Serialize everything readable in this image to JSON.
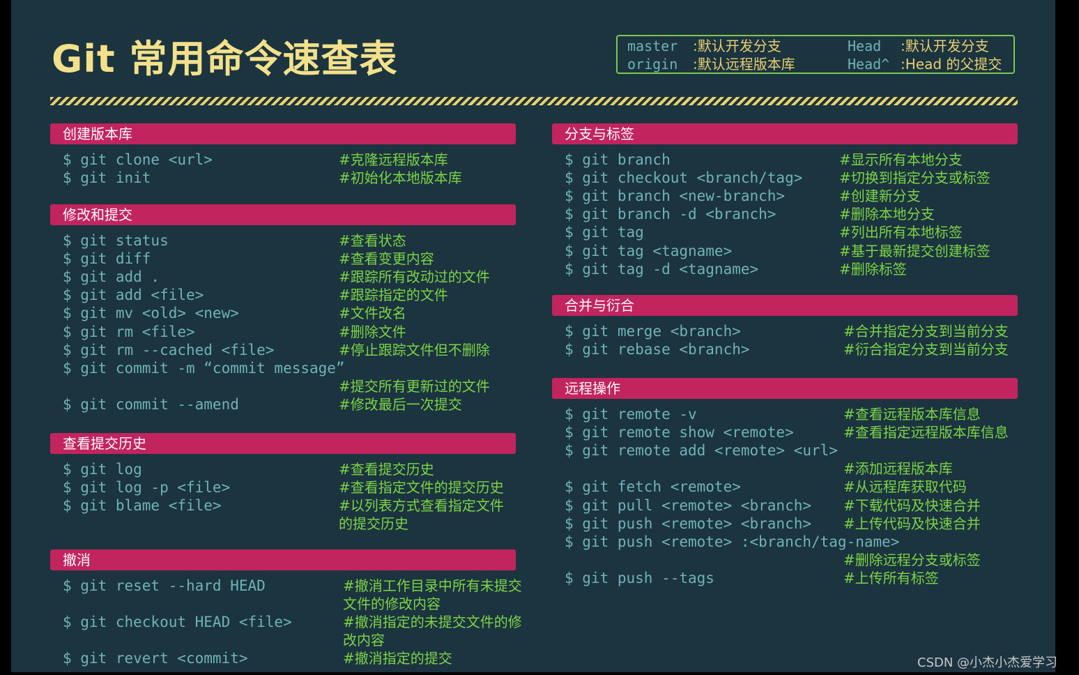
{
  "title": "Git 常用命令速查表",
  "legend": [
    {
      "key": "master",
      "val": ":默认开发分支",
      "key2": "Head",
      "val2": ":默认开发分支"
    },
    {
      "key": "origin",
      "val": ":默认远程版本库",
      "key2": "Head^",
      "val2": ":Head 的父提交"
    }
  ],
  "sections": {
    "create": {
      "title": "创建版本库",
      "lines": [
        {
          "cmd": "$ git clone <url>",
          "desc": "#克隆远程版本库"
        },
        {
          "cmd": "$ git init",
          "desc": "#初始化本地版本库"
        }
      ]
    },
    "modify": {
      "title": "修改和提交",
      "lines": [
        {
          "cmd": "$ git status",
          "desc": "#查看状态"
        },
        {
          "cmd": "$ git diff",
          "desc": "#查看变更内容"
        },
        {
          "cmd": "$ git add .",
          "desc": "#跟踪所有改动过的文件"
        },
        {
          "cmd": "$ git add <file>",
          "desc": "#跟踪指定的文件"
        },
        {
          "cmd": "$ git mv <old> <new>",
          "desc": "#文件改名"
        },
        {
          "cmd": "$ git rm <file>",
          "desc": "#删除文件"
        },
        {
          "cmd": "$ git rm --cached <file>",
          "desc": "#停止跟踪文件但不删除"
        },
        {
          "cmd": "$ git commit -m “commit message”",
          "desc": ""
        },
        {
          "cmd": "",
          "desc": "#提交所有更新过的文件"
        },
        {
          "cmd": "$ git commit --amend",
          "desc": "#修改最后一次提交"
        }
      ]
    },
    "history": {
      "title": "查看提交历史",
      "lines": [
        {
          "cmd": "$ git log",
          "desc": "#查看提交历史"
        },
        {
          "cmd": "$ git log -p <file>",
          "desc": "#查看指定文件的提交历史"
        },
        {
          "cmd": "$ git blame <file>",
          "desc": "#以列表方式查看指定文件"
        },
        {
          "cmd": "",
          "desc": "的提交历史"
        }
      ]
    },
    "undo": {
      "title": "撤消",
      "lines": [
        {
          "cmd": "$ git reset --hard HEAD",
          "desc": "#撤消工作目录中所有未提交"
        },
        {
          "cmd": "",
          "desc": "文件的修改内容"
        },
        {
          "cmd": "$ git checkout HEAD <file>",
          "desc": "#撤消指定的未提交文件的修"
        },
        {
          "cmd": "",
          "desc": "改内容"
        },
        {
          "cmd": "$ git revert <commit>",
          "desc": "#撤消指定的提交"
        }
      ]
    },
    "branch": {
      "title": "分支与标签",
      "lines": [
        {
          "cmd": "$ git branch",
          "desc": "#显示所有本地分支"
        },
        {
          "cmd": "$ git checkout <branch/tag>",
          "desc": "#切换到指定分支或标签"
        },
        {
          "cmd": "$ git branch <new-branch>",
          "desc": "#创建新分支"
        },
        {
          "cmd": "$ git branch -d <branch>",
          "desc": "#删除本地分支"
        },
        {
          "cmd": "$ git tag",
          "desc": "#列出所有本地标签"
        },
        {
          "cmd": "$ git tag <tagname>",
          "desc": "#基于最新提交创建标签"
        },
        {
          "cmd": "$ git tag -d <tagname>",
          "desc": "#删除标签"
        }
      ]
    },
    "merge": {
      "title": "合并与衍合",
      "lines": [
        {
          "cmd": "$ git merge <branch>",
          "desc": "#合并指定分支到当前分支"
        },
        {
          "cmd": "$ git rebase <branch>",
          "desc": "#衍合指定分支到当前分支"
        }
      ]
    },
    "remote": {
      "title": "远程操作",
      "lines": [
        {
          "cmd": "$ git remote -v",
          "desc": "#查看远程版本库信息"
        },
        {
          "cmd": "$ git remote show <remote>",
          "desc": "#查看指定远程版本库信息"
        },
        {
          "cmd": "$ git remote add <remote> <url>",
          "desc": ""
        },
        {
          "cmd": "",
          "desc": "#添加远程版本库"
        },
        {
          "cmd": "$ git fetch <remote>",
          "desc": "#从远程库获取代码"
        },
        {
          "cmd": "$ git pull <remote> <branch>",
          "desc": "#下载代码及快速合并"
        },
        {
          "cmd": "$ git push <remote> <branch>",
          "desc": "#上传代码及快速合并"
        },
        {
          "cmd": "$ git push <remote> :<branch/tag-name>",
          "desc": ""
        },
        {
          "cmd": "",
          "desc": "#删除远程分支或标签"
        },
        {
          "cmd": "$ git push --tags",
          "desc": "#上传所有标签"
        }
      ]
    }
  },
  "watermark": "CSDN @小杰小杰爱学习"
}
